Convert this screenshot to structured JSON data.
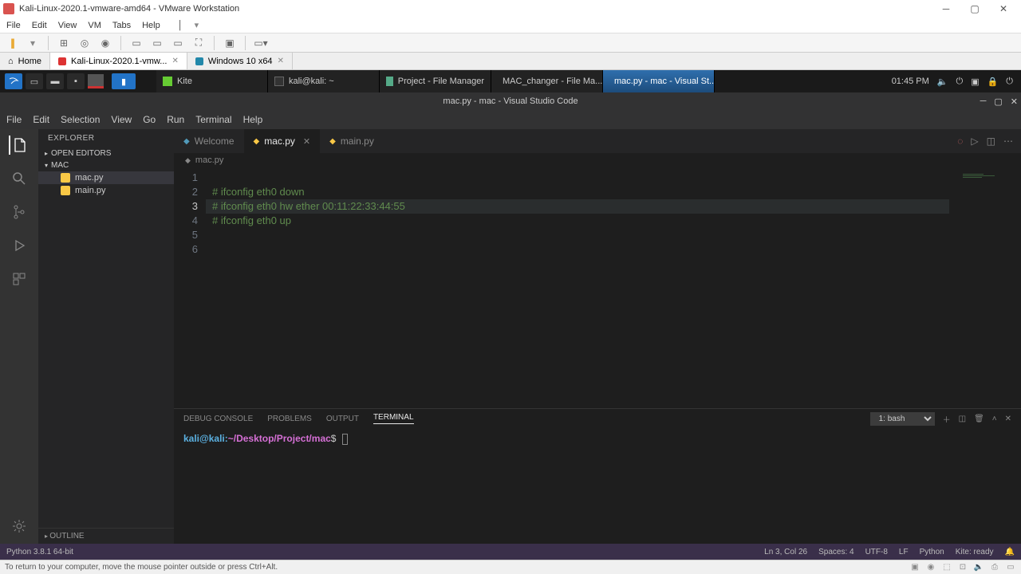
{
  "vmware": {
    "title": "Kali-Linux-2020.1-vmware-amd64 - VMware Workstation",
    "menu": [
      "File",
      "Edit",
      "View",
      "VM",
      "Tabs",
      "Help"
    ],
    "tabs": [
      {
        "label": "Home",
        "home": true
      },
      {
        "label": "Kali-Linux-2020.1-vmw...",
        "active": true
      },
      {
        "label": "Windows 10 x64"
      }
    ],
    "status_hint": "To return to your computer, move the mouse pointer outside or press Ctrl+Alt."
  },
  "kali_panel": {
    "tasks": [
      {
        "label": "Kite",
        "icon": "kite"
      },
      {
        "label": "kali@kali: ~",
        "icon": "terminal"
      },
      {
        "label": "Project - File Manager",
        "icon": "folder"
      },
      {
        "label": "MAC_changer - File Ma...",
        "icon": "folder"
      },
      {
        "label": "mac.py - mac - Visual St...",
        "icon": "vscode",
        "active": true
      }
    ],
    "clock": "01:45 PM"
  },
  "vscode": {
    "title": "mac.py - mac - Visual Studio Code",
    "menu": [
      "File",
      "Edit",
      "Selection",
      "View",
      "Go",
      "Run",
      "Terminal",
      "Help"
    ],
    "explorer": {
      "title": "EXPLORER",
      "open_editors": "OPEN EDITORS",
      "folder": "MAC",
      "files": [
        {
          "name": "mac.py",
          "selected": true
        },
        {
          "name": "main.py"
        }
      ],
      "outline": "OUTLINE"
    },
    "tabs": [
      {
        "label": "Welcome",
        "icon": "vs"
      },
      {
        "label": "mac.py",
        "icon": "py",
        "active": true
      },
      {
        "label": "main.py",
        "icon": "py"
      }
    ],
    "breadcrumb": "mac.py",
    "code_lines": [
      "",
      "# ifconfig eth0 down",
      "# ifconfig eth0 hw ether 00:11:22:33:44:55",
      "# ifconfig eth0 up",
      "",
      ""
    ],
    "active_line_index": 2,
    "panel": {
      "tabs": [
        "DEBUG CONSOLE",
        "PROBLEMS",
        "OUTPUT",
        "TERMINAL"
      ],
      "active_tab": "TERMINAL",
      "terminal_select": "1: bash",
      "prompt_user": "kali@kali",
      "prompt_sep": ":",
      "prompt_path": "~/Desktop/Project/mac",
      "prompt_end": "$"
    },
    "status": {
      "left": "Python 3.8.1 64-bit",
      "right": [
        "Ln 3, Col 26",
        "Spaces: 4",
        "UTF-8",
        "LF",
        "Python",
        "Kite: ready"
      ]
    }
  }
}
